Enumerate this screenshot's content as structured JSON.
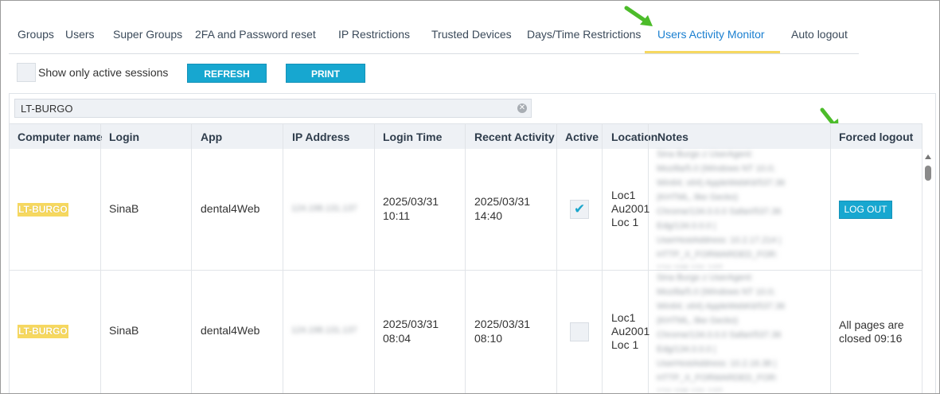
{
  "tabs": [
    {
      "label": "Groups"
    },
    {
      "label": "Users"
    },
    {
      "label": "Super Groups"
    },
    {
      "label": "2FA and Password reset"
    },
    {
      "label": "IP Restrictions"
    },
    {
      "label": "Trusted Devices"
    },
    {
      "label": "Days/Time Restrictions"
    },
    {
      "label": "Users Activity Monitor",
      "active": true
    },
    {
      "label": "Auto logout"
    }
  ],
  "toolbar": {
    "show_active_label": "Show only active sessions",
    "show_active_checked": false,
    "refresh_label": "REFRESH",
    "print_label": "PRINT"
  },
  "search": {
    "value": "LT-BURGO"
  },
  "columns": [
    "Computer name",
    "Login",
    "App",
    "IP Address",
    "Login Time",
    "Recent Activity",
    "Active",
    "Location",
    "Notes",
    "Forced logout"
  ],
  "rows": [
    {
      "computer": "LT-BURGO",
      "login": "SinaB",
      "app": "dental4Web",
      "ip": "124.198.131.137",
      "login_date": "2025/03/31",
      "login_time": "10:11",
      "recent_date": "2025/03/31",
      "recent_time": "14:40",
      "active": true,
      "loc1": "Loc1",
      "loc2": "Au2001",
      "loc3": "Loc 1",
      "notes": [
        "Sina Burgo z UserAgent:",
        "Mozilla/5.0 (Windows NT 10.0;",
        "Win64; x64) AppleWebKit/537.36",
        "(KHTML, like Gecko)",
        "Chrome/134.0.0.0 Safari/537.36",
        "Edg/134.0.0.0 |",
        "UserHostAddress: 10.2.17.214 |",
        "HTTP_X_FORWARDED_FOR:",
        "124.198.131.137"
      ],
      "forced_logout_label": "LOG OUT",
      "forced_logout_text": ""
    },
    {
      "computer": "LT-BURGO",
      "login": "SinaB",
      "app": "dental4Web",
      "ip": "124.198.131.137",
      "login_date": "2025/03/31",
      "login_time": "08:04",
      "recent_date": "2025/03/31",
      "recent_time": "08:10",
      "active": false,
      "loc1": "Loc1",
      "loc2": "Au2001",
      "loc3": "Loc 1",
      "notes": [
        "Sina Burgo z UserAgent:",
        "Mozilla/5.0 (Windows NT 10.0;",
        "Win64; x64) AppleWebKit/537.36",
        "(KHTML, like Gecko)",
        "Chrome/134.0.0.0 Safari/537.36",
        "Edg/134.0.0.0 |",
        "UserHostAddress: 10.2.16.38 |",
        "HTTP_X_FORWARDED_FOR:",
        "124.198.131.137"
      ],
      "forced_logout_label": "",
      "forced_logout_text_1": "All pages are",
      "forced_logout_text_2": "closed 09:16"
    }
  ],
  "colors": {
    "accent": "#17a7d0",
    "active_tab": "#1a7fd0",
    "highlight": "#f6d860",
    "arrow": "#4cbc2a"
  },
  "icons": {
    "arrow": "arrow-icon",
    "clear": "clear-icon",
    "check": "check-icon"
  }
}
